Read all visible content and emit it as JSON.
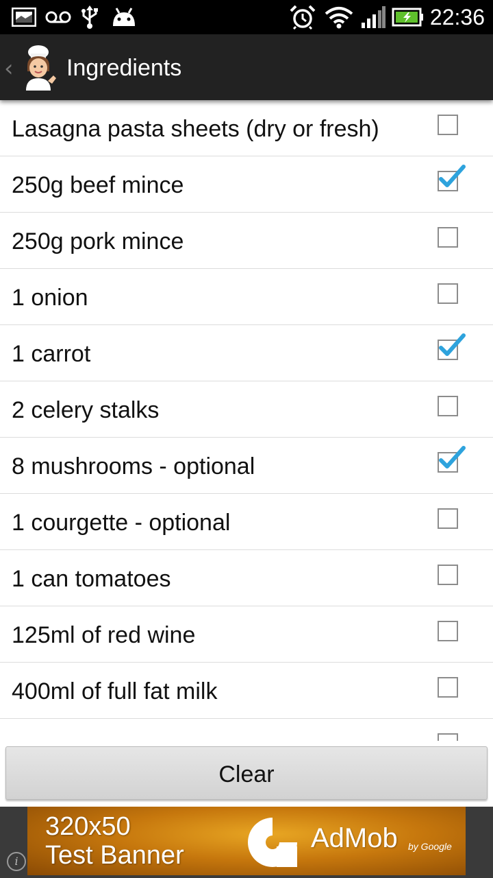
{
  "status_bar": {
    "time": "22:36",
    "icons": [
      "gallery-icon",
      "voicemail-icon",
      "usb-icon",
      "android-debug-icon",
      "alarm-icon",
      "wifi-icon",
      "signal-icon",
      "battery-charging-icon"
    ]
  },
  "action_bar": {
    "title": "Ingredients",
    "logo": "chef-icon"
  },
  "ingredients": [
    {
      "label": "Lasagna pasta sheets (dry or fresh)",
      "checked": false
    },
    {
      "label": "250g beef mince",
      "checked": true
    },
    {
      "label": "250g pork mince",
      "checked": false
    },
    {
      "label": "1 onion",
      "checked": false
    },
    {
      "label": "1 carrot",
      "checked": true
    },
    {
      "label": "2 celery stalks",
      "checked": false
    },
    {
      "label": "8 mushrooms - optional",
      "checked": true
    },
    {
      "label": "1 courgette - optional",
      "checked": false
    },
    {
      "label": "1 can tomatoes",
      "checked": false
    },
    {
      "label": "125ml of red wine",
      "checked": false
    },
    {
      "label": "400ml of full fat milk",
      "checked": false
    }
  ],
  "clear_button": {
    "label": "Clear"
  },
  "ad": {
    "line1": "320x50",
    "line2": "Test Banner",
    "brand": "AdMob",
    "by": "by Google",
    "info_glyph": "i"
  },
  "colors": {
    "status_bar_bg": "#000000",
    "action_bar_bg": "#222222",
    "check_accent": "#2ea3dd",
    "ad_orange": "#d98d14"
  }
}
